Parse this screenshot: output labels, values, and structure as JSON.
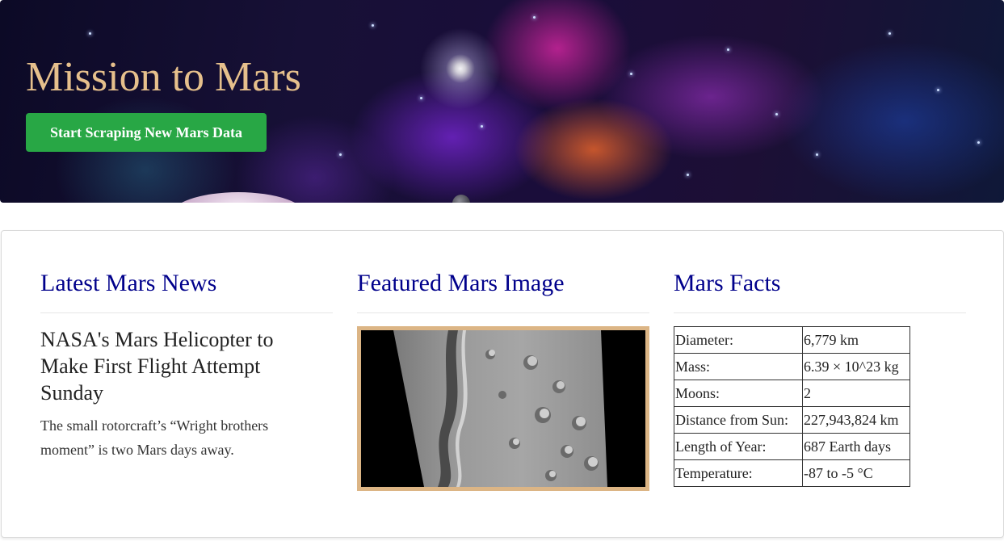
{
  "header": {
    "title": "Mission to Mars",
    "scrape_button_label": "Start Scraping New Mars Data"
  },
  "news": {
    "heading": "Latest Mars News",
    "title": "NASA's Mars Helicopter to Make First Flight Attempt Sunday",
    "teaser": "The small rotorcraft’s “Wright brothers moment” is two Mars days away."
  },
  "featured_image": {
    "heading": "Featured Mars Image",
    "frame_color": "#dcb585"
  },
  "facts": {
    "heading": "Mars Facts",
    "rows": [
      {
        "label": "Diameter:",
        "value": "6,779 km"
      },
      {
        "label": "Mass:",
        "value": "6.39 × 10^23 kg"
      },
      {
        "label": "Moons:",
        "value": "2"
      },
      {
        "label": "Distance from Sun:",
        "value": "227,943,824 km"
      },
      {
        "label": "Length of Year:",
        "value": "687 Earth days"
      },
      {
        "label": "Temperature:",
        "value": "-87 to -5 °C"
      }
    ]
  },
  "colors": {
    "title": "#e6c08c",
    "button": "#28a745",
    "headings": "#00008b"
  }
}
